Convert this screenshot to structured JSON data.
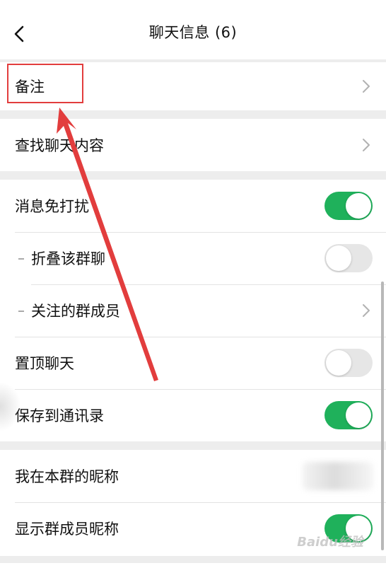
{
  "nav": {
    "title": "聊天信息 (6)",
    "back_icon": "chevron-left-icon"
  },
  "rows": {
    "remark": {
      "label": "备注"
    },
    "search_history": {
      "label": "查找聊天内容"
    },
    "mute": {
      "label": "消息免打扰",
      "on": true
    },
    "fold": {
      "label": "折叠该群聊",
      "on": false
    },
    "followed": {
      "label": "关注的群成员"
    },
    "pin": {
      "label": "置顶聊天",
      "on": false
    },
    "save_contacts": {
      "label": "保存到通讯录",
      "on": true
    },
    "my_nickname": {
      "label": "我在本群的昵称"
    },
    "show_nicknames": {
      "label": "显示群成员昵称",
      "on": true
    }
  },
  "colors": {
    "toggle_on": "#1fb15b",
    "toggle_off": "#e6e6e6",
    "annotation": "#e23d3d"
  },
  "watermark": "Baidu经验"
}
